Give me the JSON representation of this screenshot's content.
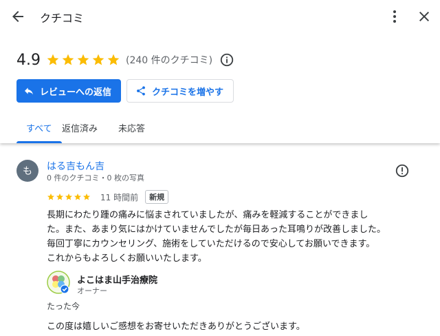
{
  "header": {
    "title": "クチコミ"
  },
  "icons": {
    "back": "arrow-left-icon",
    "more": "more-vert-icon",
    "close": "close-icon",
    "info": "info-icon",
    "reply": "reply-icon",
    "share": "share-icon",
    "flag": "report-icon",
    "verified": "verified-check-icon"
  },
  "summary": {
    "rating": "4.9",
    "stars": 5,
    "count_text": "(240 件のクチコミ)"
  },
  "buttons": {
    "reply_label": "レビューへの返信",
    "increase_label": "クチコミを増やす"
  },
  "tabs": [
    {
      "label": "すべて",
      "active": true
    },
    {
      "label": "返信済み",
      "active": false
    },
    {
      "label": "未応答",
      "active": false
    }
  ],
  "review": {
    "avatar_letter": "も",
    "reviewer_name": "はる吉もん吉",
    "reviewer_meta": "0 件のクチコミ・0 枚の写真",
    "stars": 5,
    "time": "11 時間前",
    "badge": "新規",
    "lines": [
      "長期にわたり踵の痛みに悩まされていましたが、痛みを軽減することができまし",
      "た。また、あまり気にはかけていませんでしたが毎日あった耳鳴りが改善しました。",
      "毎回丁寧にカウンセリング、施術をしていただけるので安心してお願いできます。",
      "これからもよろしくお願いいたします。"
    ]
  },
  "owner_reply": {
    "business_name": "よこはま山手治療院",
    "role": "オーナー",
    "time": "たった今",
    "text": "この度は嬉しいご感想をお寄せいただきありがとうございます。"
  },
  "colors": {
    "accent": "#1a73e8",
    "star": "#fbbc04",
    "avatar_bg": "#5f6f7e"
  }
}
